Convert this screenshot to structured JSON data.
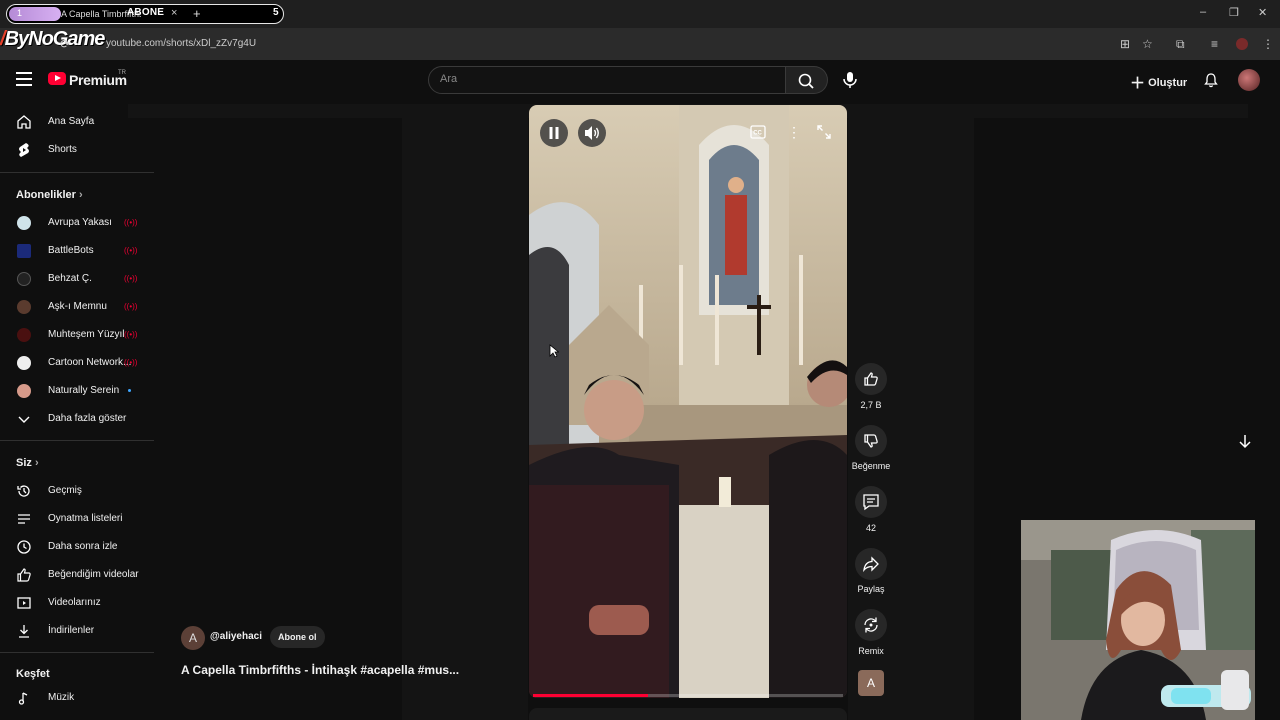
{
  "browser": {
    "tab_number": "1",
    "tab_title": "A Capella Timbrfifths",
    "tab_overlay_text": "ABONE",
    "tab_close": "×",
    "new_tab": "+",
    "tab_count": "5",
    "overlay_logo": "ByNoGame",
    "url": "youtube.com/shorts/xDl_zZv7g4U",
    "window_controls": [
      "–",
      "❐",
      "✕"
    ]
  },
  "header": {
    "brand": "Premium",
    "brand_region": "TR",
    "search_placeholder": "Ara",
    "create_label": "Oluştur"
  },
  "sidebar": {
    "main": [
      {
        "label": "Ana Sayfa",
        "icon": "home-icon"
      },
      {
        "label": "Shorts",
        "icon": "shorts-icon"
      }
    ],
    "subscriptions_title": "Abonelikler",
    "subscriptions": [
      {
        "label": "Avrupa Yakası",
        "badge": "live",
        "color": "#cfe3ea"
      },
      {
        "label": "BattleBots",
        "badge": "live",
        "color": "#1b2a7a"
      },
      {
        "label": "Behzat Ç.",
        "badge": "live",
        "color": "#222222"
      },
      {
        "label": "Aşk-ı Memnu",
        "badge": "live",
        "color": "#5a3b2e"
      },
      {
        "label": "Muhteşem Yüzyıl",
        "badge": "live",
        "color": "#4a1010"
      },
      {
        "label": "Cartoon Network...",
        "badge": "live",
        "color": "#eeeeee"
      },
      {
        "label": "Naturally Serein",
        "badge": "new",
        "color": "#d69a8a"
      }
    ],
    "show_more": "Daha fazla göster",
    "you_title": "Siz",
    "you": [
      {
        "label": "Geçmiş",
        "icon": "history-icon"
      },
      {
        "label": "Oynatma listeleri",
        "icon": "playlists-icon"
      },
      {
        "label": "Daha sonra izle",
        "icon": "watch-later-icon"
      },
      {
        "label": "Beğendiğim videolar",
        "icon": "liked-videos-icon"
      },
      {
        "label": "Videolarınız",
        "icon": "your-videos-icon"
      },
      {
        "label": "İndirilenler",
        "icon": "downloads-icon"
      }
    ],
    "explore_title": "Keşfet",
    "explore": [
      {
        "label": "Müzik",
        "icon": "music-icon"
      }
    ],
    "live_glyph": "((•))"
  },
  "short": {
    "channel_handle": "@aliyehaci",
    "channel_initial": "A",
    "subscribe_label": "Abone ol",
    "title": "A Capella Timbrfifths - İntihaşk #acapella #mus...",
    "progress_fraction": 0.37,
    "actions": {
      "like_count": "2,7 B",
      "dislike_label": "Beğenme",
      "comment_count": "42",
      "share_label": "Paylaş",
      "remix_label": "Remix"
    },
    "sound_avatar_initial": "A"
  }
}
